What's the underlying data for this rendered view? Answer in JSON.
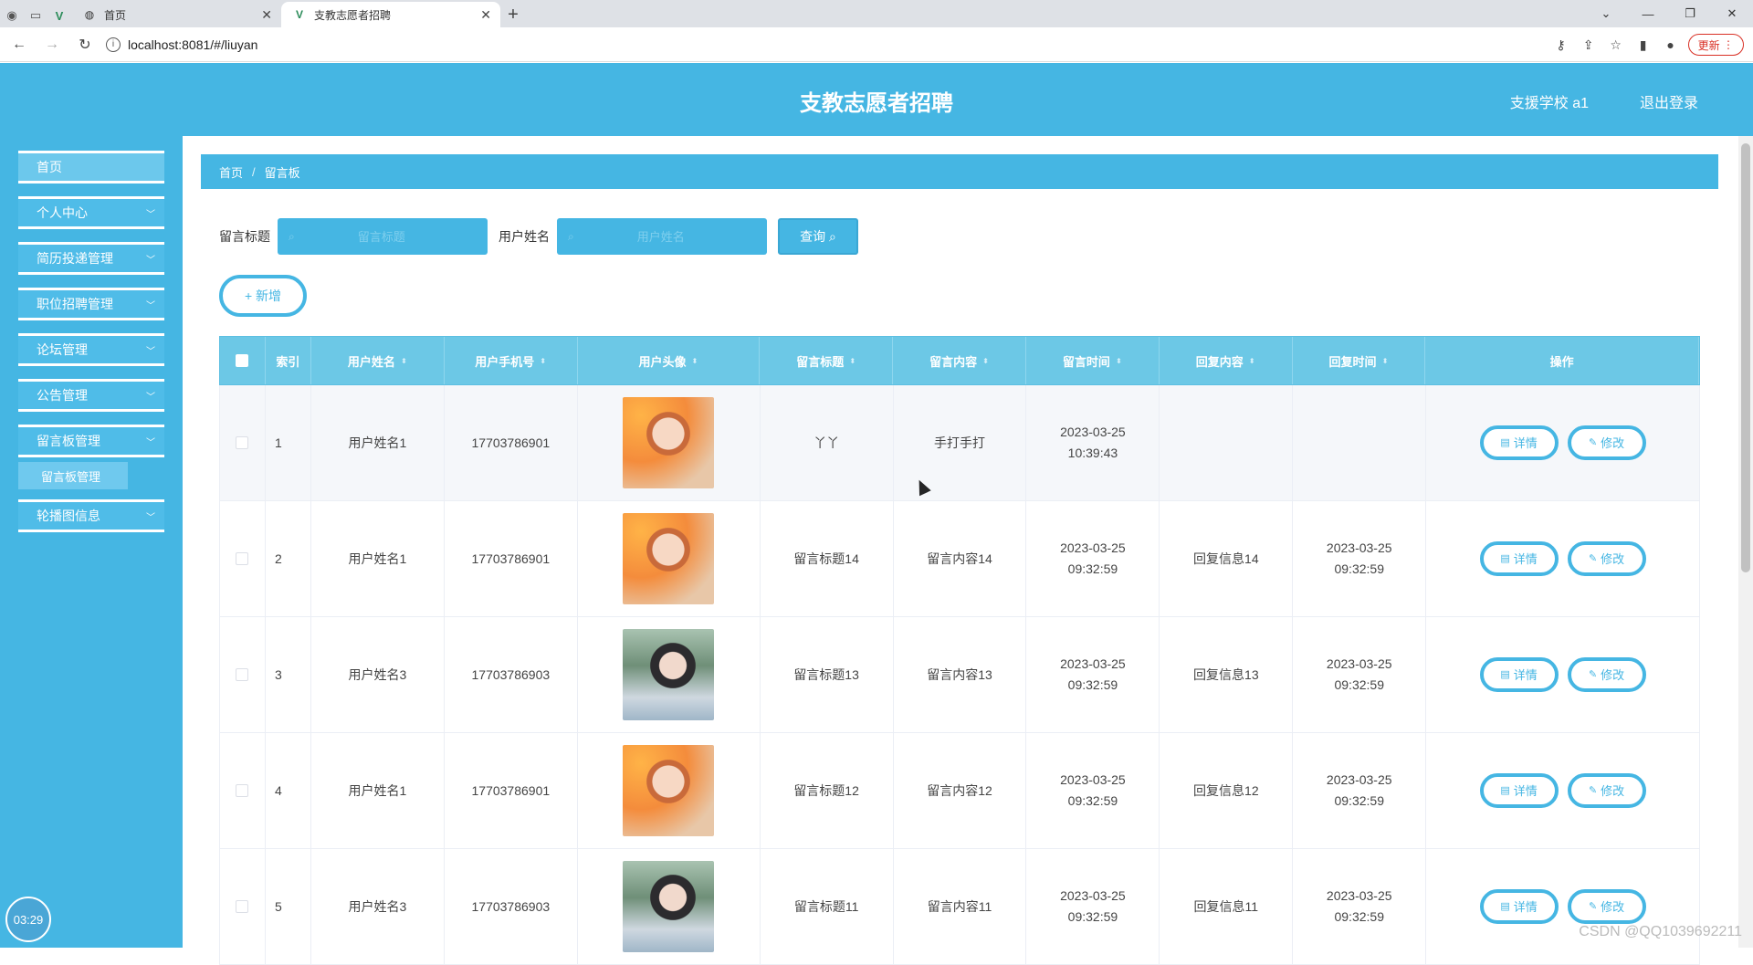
{
  "browser": {
    "tabs": [
      {
        "label": "首页",
        "active": false
      },
      {
        "label": "支教志愿者招聘",
        "active": true
      }
    ],
    "url": "localhost:8081/#/liuyan",
    "update_label": "更新"
  },
  "header": {
    "title": "支教志愿者招聘",
    "user": "支援学校 a1",
    "logout": "退出登录"
  },
  "sidebar": {
    "items": [
      {
        "label": "首页"
      },
      {
        "label": "个人中心"
      },
      {
        "label": "简历投递管理"
      },
      {
        "label": "职位招聘管理"
      },
      {
        "label": "论坛管理"
      },
      {
        "label": "公告管理"
      },
      {
        "label": "留言板管理"
      },
      {
        "label": "轮播图信息"
      }
    ],
    "sub_item": "留言板管理",
    "clock": "03:29"
  },
  "breadcrumb": {
    "home": "首页",
    "sep": "/",
    "current": "留言板"
  },
  "search": {
    "title_label": "留言标题",
    "title_placeholder": "留言标题",
    "name_label": "用户姓名",
    "name_placeholder": "用户姓名",
    "query_label": "查询"
  },
  "add_label": "+ 新增",
  "table": {
    "headers": [
      "索引",
      "用户姓名",
      "用户手机号",
      "用户头像",
      "留言标题",
      "留言内容",
      "留言时间",
      "回复内容",
      "回复时间",
      "操作"
    ],
    "rows": [
      {
        "index": "1",
        "name": "用户姓名1",
        "phone": "17703786901",
        "avatar": "a1",
        "title": "丫丫",
        "content": "手打手打",
        "time": "2023-03-25 10:39:43",
        "reply": "",
        "reply_time": ""
      },
      {
        "index": "2",
        "name": "用户姓名1",
        "phone": "17703786901",
        "avatar": "a1",
        "title": "留言标题14",
        "content": "留言内容14",
        "time": "2023-03-25 09:32:59",
        "reply": "回复信息14",
        "reply_time": "2023-03-25 09:32:59"
      },
      {
        "index": "3",
        "name": "用户姓名3",
        "phone": "17703786903",
        "avatar": "a2",
        "title": "留言标题13",
        "content": "留言内容13",
        "time": "2023-03-25 09:32:59",
        "reply": "回复信息13",
        "reply_time": "2023-03-25 09:32:59"
      },
      {
        "index": "4",
        "name": "用户姓名1",
        "phone": "17703786901",
        "avatar": "a1",
        "title": "留言标题12",
        "content": "留言内容12",
        "time": "2023-03-25 09:32:59",
        "reply": "回复信息12",
        "reply_time": "2023-03-25 09:32:59"
      },
      {
        "index": "5",
        "name": "用户姓名3",
        "phone": "17703786903",
        "avatar": "a2",
        "title": "留言标题11",
        "content": "留言内容11",
        "time": "2023-03-25 09:32:59",
        "reply": "回复信息11",
        "reply_time": "2023-03-25 09:32:59"
      }
    ],
    "detail_label": "详情",
    "edit_label": "修改"
  },
  "watermark": "CSDN @QQ1039692211",
  "colors": {
    "primary": "#45b6e3",
    "header_row": "#6cc8e6"
  }
}
